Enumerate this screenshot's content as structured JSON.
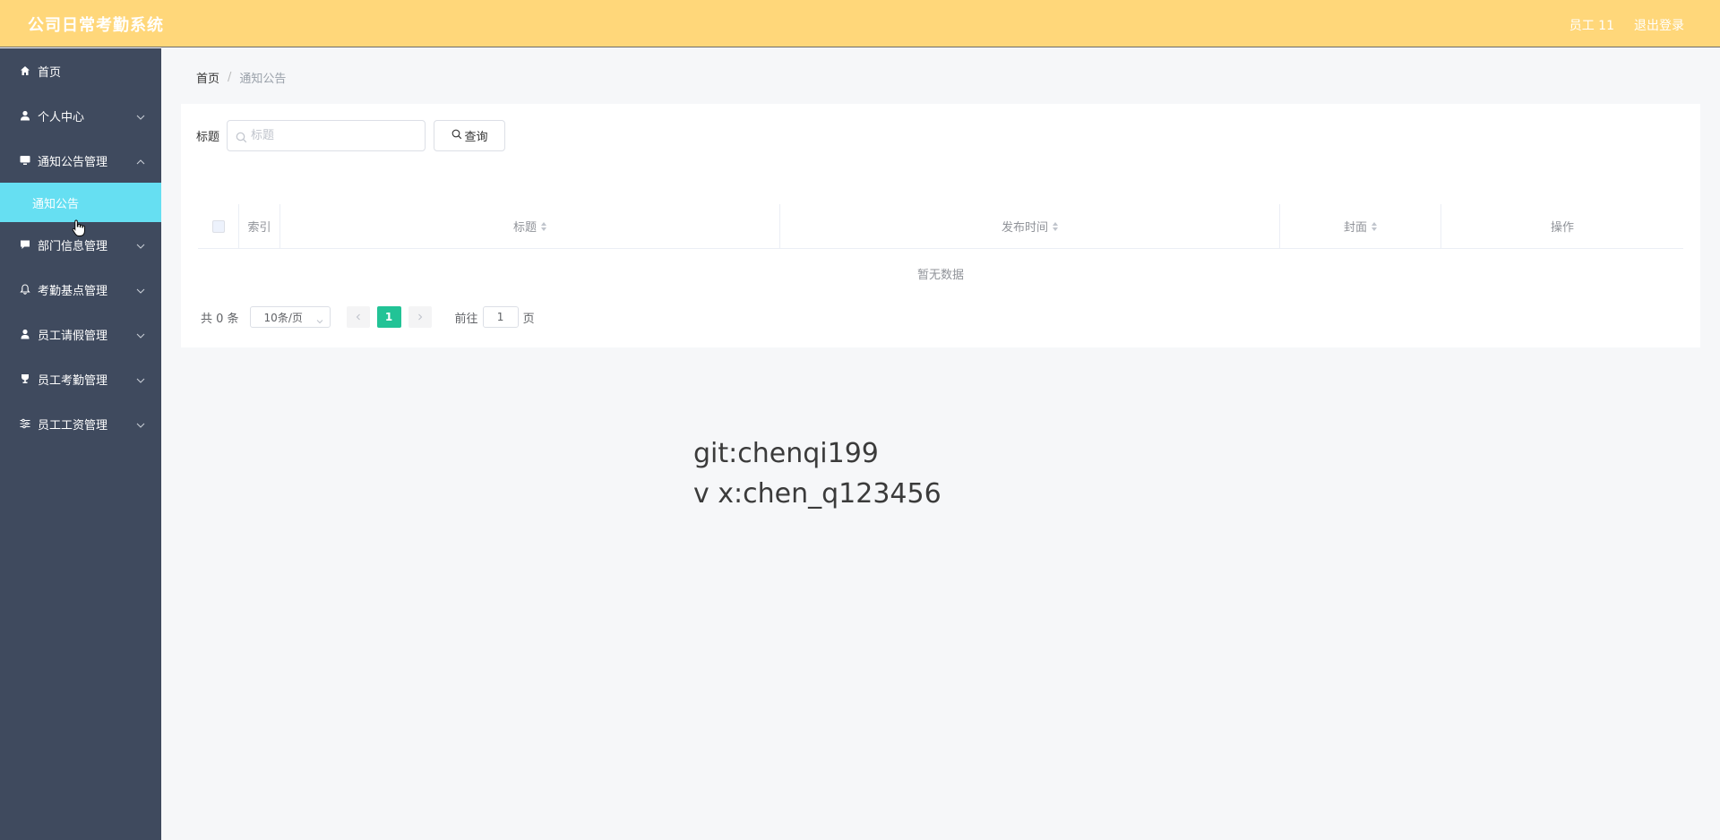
{
  "app": {
    "title": "公司日常考勤系统",
    "user_label": "员工 11",
    "logout_label": "退出登录"
  },
  "sidebar": {
    "items": [
      {
        "label": "首页",
        "icon": "home-icon",
        "expandable": false
      },
      {
        "label": "个人中心",
        "icon": "user-icon",
        "expandable": true,
        "expanded": false
      },
      {
        "label": "通知公告管理",
        "icon": "monitor-icon",
        "expandable": true,
        "expanded": true
      },
      {
        "label": "部门信息管理",
        "icon": "chat-icon",
        "expandable": true,
        "expanded": false
      },
      {
        "label": "考勤基点管理",
        "icon": "bell-icon",
        "expandable": true,
        "expanded": false
      },
      {
        "label": "员工请假管理",
        "icon": "person-icon",
        "expandable": true,
        "expanded": false
      },
      {
        "label": "员工考勤管理",
        "icon": "trophy-icon",
        "expandable": true,
        "expanded": false
      },
      {
        "label": "员工工资管理",
        "icon": "sliders-icon",
        "expandable": true,
        "expanded": false
      }
    ],
    "submenu": {
      "label": "通知公告",
      "active": true
    }
  },
  "breadcrumb": {
    "home": "首页",
    "separator": "/",
    "current": "通知公告"
  },
  "search": {
    "label": "标题",
    "placeholder": "标题",
    "value": "",
    "button_label": "查询"
  },
  "table": {
    "columns": [
      {
        "label": "",
        "type": "checkbox"
      },
      {
        "label": "索引",
        "sortable": false
      },
      {
        "label": "标题",
        "sortable": true
      },
      {
        "label": "发布时间",
        "sortable": true
      },
      {
        "label": "封面",
        "sortable": true
      },
      {
        "label": "操作",
        "sortable": false
      }
    ],
    "rows": [],
    "empty_text": "暂无数据"
  },
  "pagination": {
    "total_text": "共 0 条",
    "page_size": "10条/页",
    "current_page": "1",
    "goto_label": "前往",
    "goto_value": "1",
    "page_suffix": "页"
  },
  "watermark": {
    "line1": "git:chenqi199",
    "line2": "v x:chen_q123456"
  },
  "colors": {
    "header_bg": "#ffd77a",
    "sidebar_bg": "#3f4a5e",
    "submenu_active_bg": "#66dff2",
    "page_active_bg": "#22c396"
  }
}
